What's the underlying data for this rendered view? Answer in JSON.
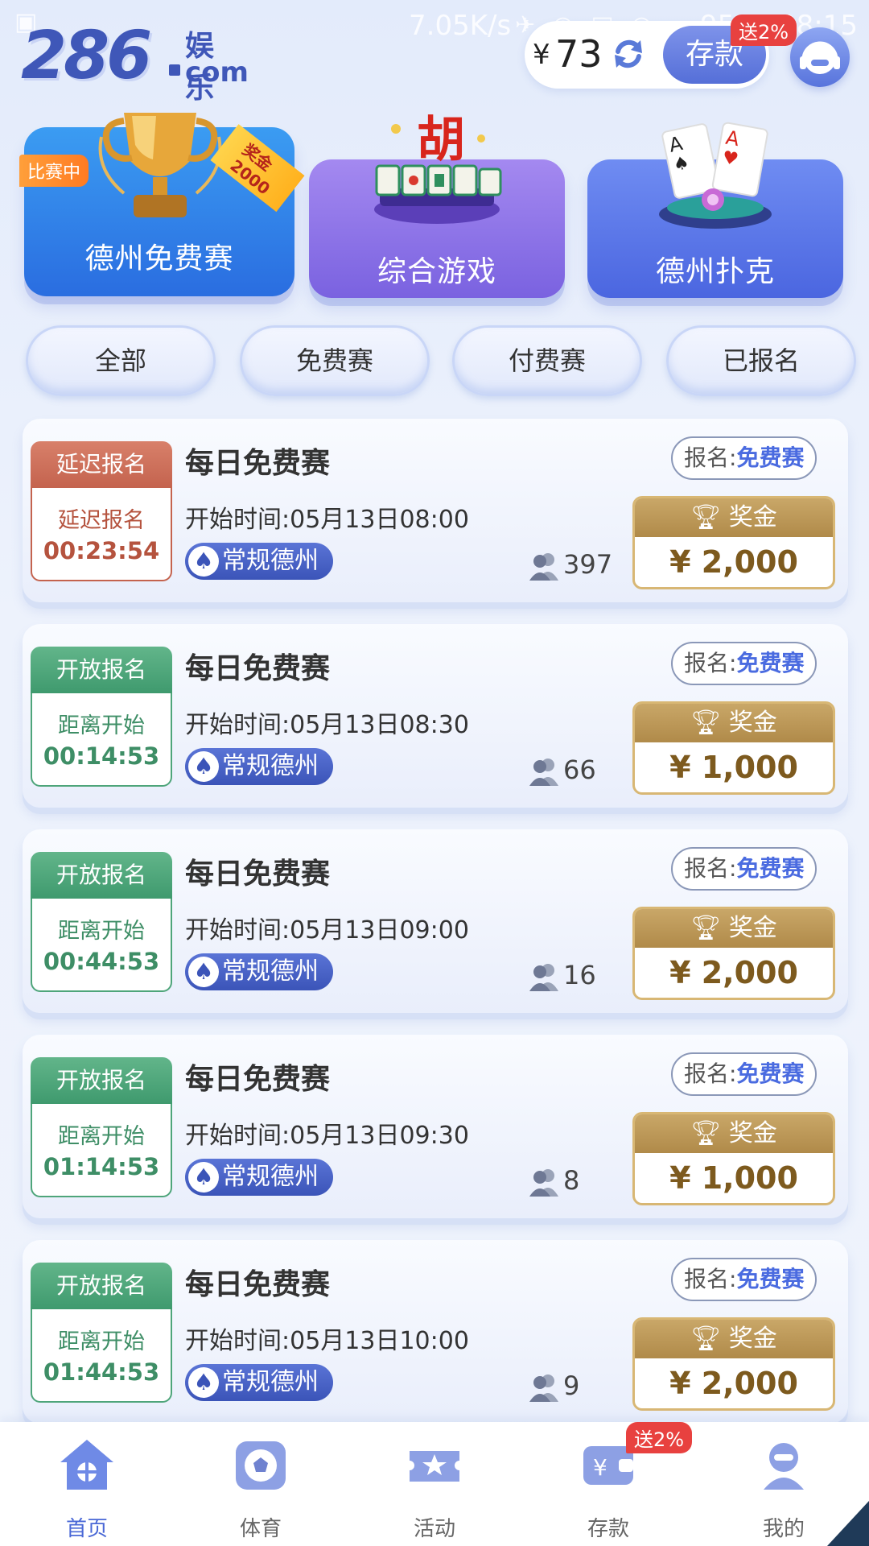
{
  "status_bar": {
    "speed": "7.05K/s",
    "battery": "95",
    "time": "08:15"
  },
  "header": {
    "logo_number": "286",
    "logo_cn": "娱乐",
    "logo_com": "com",
    "currency": "¥",
    "balance": "73",
    "deposit_label": "存款",
    "deposit_badge": "送2%"
  },
  "categories": [
    {
      "label": "德州免费赛",
      "tag_live": "比赛中",
      "tag_prize": "奖金2000"
    },
    {
      "label": "综合游戏"
    },
    {
      "label": "德州扑克"
    }
  ],
  "tabs": [
    "全部",
    "免费赛",
    "付费赛",
    "已报名"
  ],
  "tournaments": [
    {
      "status": "延迟报名",
      "state": "late",
      "countdown_label": "延迟报名",
      "countdown": "00:23:54",
      "title": "每日免费赛",
      "start_time": "开始时间:05月13日08:00",
      "game_type": "常规德州",
      "players": "397",
      "signup_label": "报名:",
      "signup_value": "免费赛",
      "prize_label": "奖金",
      "prize": "¥ 2,000"
    },
    {
      "status": "开放报名",
      "state": "open",
      "countdown_label": "距离开始",
      "countdown": "00:14:53",
      "title": "每日免费赛",
      "start_time": "开始时间:05月13日08:30",
      "game_type": "常规德州",
      "players": "66",
      "signup_label": "报名:",
      "signup_value": "免费赛",
      "prize_label": "奖金",
      "prize": "¥ 1,000"
    },
    {
      "status": "开放报名",
      "state": "open",
      "countdown_label": "距离开始",
      "countdown": "00:44:53",
      "title": "每日免费赛",
      "start_time": "开始时间:05月13日09:00",
      "game_type": "常规德州",
      "players": "16",
      "signup_label": "报名:",
      "signup_value": "免费赛",
      "prize_label": "奖金",
      "prize": "¥ 2,000"
    },
    {
      "status": "开放报名",
      "state": "open",
      "countdown_label": "距离开始",
      "countdown": "01:14:53",
      "title": "每日免费赛",
      "start_time": "开始时间:05月13日09:30",
      "game_type": "常规德州",
      "players": "8",
      "signup_label": "报名:",
      "signup_value": "免费赛",
      "prize_label": "奖金",
      "prize": "¥ 1,000"
    },
    {
      "status": "开放报名",
      "state": "open",
      "countdown_label": "距离开始",
      "countdown": "01:44:53",
      "title": "每日免费赛",
      "start_time": "开始时间:05月13日10:00",
      "game_type": "常规德州",
      "players": "9",
      "signup_label": "报名:",
      "signup_value": "免费赛",
      "prize_label": "奖金",
      "prize": "¥ 2,000"
    }
  ],
  "bottom_nav": {
    "items": [
      {
        "label": "首页",
        "icon": "home-icon",
        "active": true
      },
      {
        "label": "体育",
        "icon": "soccer-ball-icon"
      },
      {
        "label": "活动",
        "icon": "ticket-star-icon"
      },
      {
        "label": "存款",
        "icon": "wallet-yen-icon"
      },
      {
        "label": "我的",
        "icon": "user-icon"
      }
    ],
    "deposit_badge": "送2%"
  },
  "colors": {
    "brand": "#3f57b8",
    "accent": "#4a6be0",
    "open": "#3f9a6e",
    "late": "#c4634e",
    "prize": "#b08a49"
  }
}
